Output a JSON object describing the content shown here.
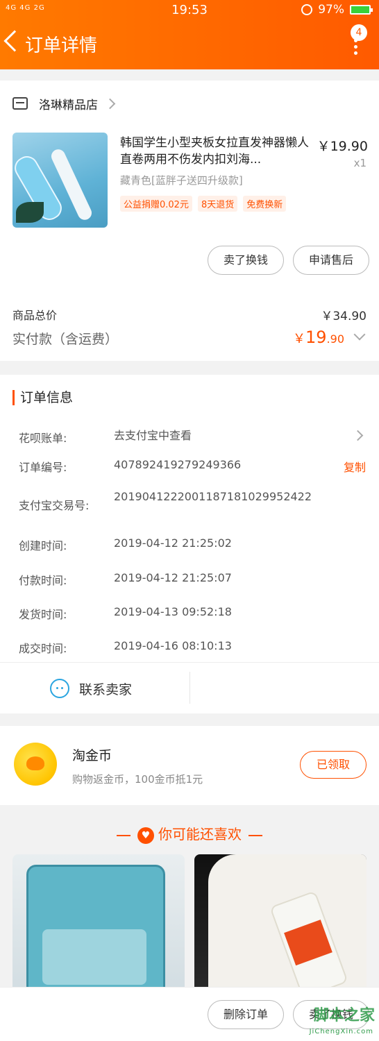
{
  "status_bar": {
    "network": "4G 4G 2G",
    "time": "19:53",
    "battery": "97%"
  },
  "header": {
    "title": "订单详情",
    "badge_count": "4"
  },
  "shop": {
    "name": "洛琳精品店"
  },
  "product": {
    "title": "韩国学生小型夹板女拉直发神器懒人直卷两用不伤发内扣刘海...",
    "price": "￥19.90",
    "qty": "x1",
    "spec": "藏青色[蓝胖子送四升级款]",
    "tags": [
      "公益捐赠0.02元",
      "8天退货",
      "免费换新"
    ]
  },
  "actions": {
    "sell_exchange": "卖了换钱",
    "after_sale": "申请售后"
  },
  "price_summary": {
    "total_label": "商品总价",
    "total_value": "￥34.90",
    "paid_label": "实付款（含运费）",
    "paid_yen": "￥",
    "paid_int": "19",
    "paid_dec": ".90"
  },
  "order_info": {
    "title": "订单信息",
    "rows": [
      {
        "key": "花呗账单:",
        "value": "去支付宝中查看"
      },
      {
        "key": "订单编号:",
        "value": "407892419279249366",
        "action": "复制"
      },
      {
        "key": "支付宝交易号:",
        "value": "2019041222001187181029952422"
      },
      {
        "key": "创建时间:",
        "value": "2019-04-12 21:25:02"
      },
      {
        "key": "付款时间:",
        "value": "2019-04-12 21:25:07"
      },
      {
        "key": "发货时间:",
        "value": "2019-04-13 09:52:18"
      },
      {
        "key": "成交时间:",
        "value": "2019-04-16 08:10:13"
      }
    ],
    "contact_label": "联系卖家"
  },
  "coins": {
    "title": "淘金币",
    "subtitle": "购物返金币，100金币抵1元",
    "button": "已领取"
  },
  "recommend": {
    "title": "你可能还喜欢"
  },
  "bottom": {
    "delete_order": "删除订单",
    "sell_exchange": "卖了换钱",
    "watermark": "脚本之家",
    "watermark_sub": "JiChengXin.com"
  }
}
